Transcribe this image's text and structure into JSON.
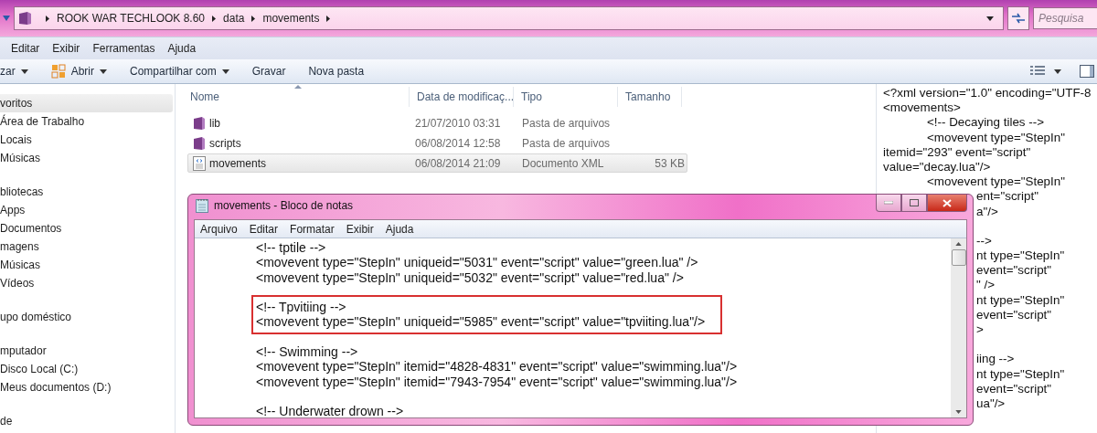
{
  "address_bar": {
    "path": [
      "ROOK WAR TECHLOOK 8.60",
      "data",
      "movements"
    ]
  },
  "search": {
    "placeholder": "Pesquisa"
  },
  "menu": [
    "Editar",
    "Exibir",
    "Ferramentas",
    "Ajuda"
  ],
  "toolbar": [
    {
      "label": "zar",
      "kind": "dropdown"
    },
    {
      "label": "Abrir",
      "kind": "open"
    },
    {
      "label": "Compartilhar com",
      "kind": "dropdown"
    },
    {
      "label": "Gravar",
      "kind": "plain"
    },
    {
      "label": "Nova pasta",
      "kind": "plain"
    }
  ],
  "sidebar": {
    "items": [
      {
        "label": "voritos",
        "selected": true,
        "children": [
          {
            "label": "Área de Trabalho",
            "selected": false
          },
          {
            "label": "Locais",
            "selected": false
          },
          {
            "label": "Músicas",
            "selected": false
          }
        ]
      },
      {
        "label": "bliotecas",
        "selected": false,
        "children": [
          {
            "label": "Apps",
            "selected": false
          },
          {
            "label": "Documentos",
            "selected": false
          },
          {
            "label": "magens",
            "selected": false
          },
          {
            "label": "Músicas",
            "selected": false
          },
          {
            "label": "Vídeos",
            "selected": false
          }
        ]
      },
      {
        "label": "upo doméstico",
        "selected": false
      },
      {
        "label": "mputador",
        "selected": false,
        "children": [
          {
            "label": "Disco Local (C:)",
            "selected": false
          },
          {
            "label": "Meus documentos (D:)",
            "selected": false
          }
        ]
      },
      {
        "label": "de",
        "selected": false
      }
    ]
  },
  "file_list": {
    "columns": [
      "Nome",
      "Data de modificaç...",
      "Tipo",
      "Tamanho"
    ],
    "rows": [
      {
        "name": "lib",
        "kind": "folder",
        "date": "21/07/2010 03:31",
        "type": "Pasta de arquivos",
        "selected": false
      },
      {
        "name": "scripts",
        "kind": "folder",
        "date": "06/08/2014 12:58",
        "type": "Pasta de arquivos",
        "selected": false
      },
      {
        "name": "movements",
        "kind": "xml",
        "date": "06/08/2014 21:09",
        "type": "Documento XML",
        "size": "53 KB",
        "selected": true
      }
    ]
  },
  "preview": {
    "blocks": [
      {
        "lines": [
          {
            "text": "<?xml version=\"1.0\" encoding=\"UTF-8",
            "kind": "full"
          },
          {
            "text": "<movements>",
            "kind": "full"
          },
          {
            "text": "<!-- Decaying tiles -->",
            "kind": "indented"
          },
          {
            "text": "<movevent type=\"StepIn\"",
            "kind": "indented"
          },
          {
            "text": "itemid=\"293\" event=\"script\"",
            "kind": "full"
          },
          {
            "text": "value=\"decay.lua\"/>",
            "kind": "full"
          },
          {
            "text": "<movevent type=\"StepIn\"",
            "kind": "indented"
          },
          {
            "text": "ent=\"script\"",
            "kind": "fragment"
          },
          {
            "text": "a\"/>",
            "kind": "fragment"
          }
        ]
      },
      {
        "lines": [
          {
            "text": "-->",
            "kind": "fragment"
          },
          {
            "text": "nt type=\"StepIn\"",
            "kind": "fragment"
          },
          {
            "text": "event=\"script\"",
            "kind": "fragment"
          },
          {
            "text": "\" />",
            "kind": "fragment"
          },
          {
            "text": "nt type=\"StepIn\"",
            "kind": "fragment"
          },
          {
            "text": "event=\"script\"",
            "kind": "fragment"
          },
          {
            "text": ">",
            "kind": "fragment"
          }
        ]
      },
      {
        "lines": [
          {
            "text": "iing -->",
            "kind": "fragment"
          },
          {
            "text": "nt type=\"StepIn\"",
            "kind": "fragment"
          },
          {
            "text": "event=\"script\"",
            "kind": "fragment"
          },
          {
            "text": "ua\"/>",
            "kind": "fragment"
          }
        ]
      }
    ]
  },
  "notepad": {
    "title": "movements - Bloco de notas",
    "menu": [
      "Arquivo",
      "Editar",
      "Formatar",
      "Exibir",
      "Ajuda"
    ],
    "blocks": [
      {
        "highlighted": false,
        "lines": [
          "<!-- tptile -->",
          "<movevent type=\"StepIn\" uniqueid=\"5031\" event=\"script\" value=\"green.lua\" />",
          "<movevent type=\"StepIn\" uniqueid=\"5032\" event=\"script\" value=\"red.lua\" />"
        ]
      },
      {
        "highlighted": true,
        "lines": [
          "<!-- Tpvitiing -->",
          "<movevent type=\"StepIn\" uniqueid=\"5985\" event=\"script\" value=\"tpviiting.lua\"/>"
        ]
      },
      {
        "highlighted": false,
        "lines": [
          "<!-- Swimming -->",
          "<movevent type=\"StepIn\" itemid=\"4828-4831\" event=\"script\" value=\"swimming.lua\"/>",
          "<movevent type=\"StepIn\" itemid=\"7943-7954\" event=\"script\" value=\"swimming.lua\"/>"
        ]
      },
      {
        "highlighted": false,
        "lines": [
          "<!-- Underwater drown -->"
        ]
      }
    ]
  }
}
